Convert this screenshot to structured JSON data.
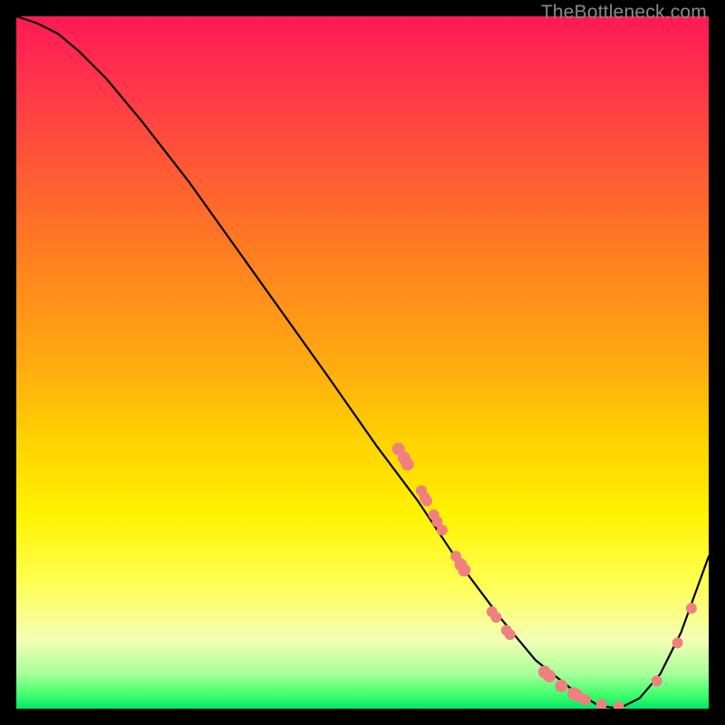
{
  "watermark": "TheBottleneck.com",
  "chart_data": {
    "type": "line",
    "title": "",
    "xlabel": "",
    "ylabel": "",
    "xlim": [
      0,
      100
    ],
    "ylim": [
      0,
      100
    ],
    "grid": false,
    "legend": false,
    "series": [
      {
        "name": "curve",
        "x": [
          0,
          3,
          6,
          9,
          13,
          18,
          25,
          35,
          45,
          52,
          58,
          64,
          70,
          75,
          80,
          84,
          87,
          90,
          93,
          96,
          100
        ],
        "y": [
          100,
          99,
          97.5,
          95,
          91,
          85,
          76,
          62,
          48,
          38,
          30,
          21,
          13,
          7,
          3,
          0.5,
          0,
          1.5,
          5,
          11,
          22
        ]
      }
    ],
    "points": [
      {
        "x": 55.2,
        "y": 37.5,
        "r": 7
      },
      {
        "x": 56.0,
        "y": 36.2,
        "r": 7
      },
      {
        "x": 56.5,
        "y": 35.3,
        "r": 7
      },
      {
        "x": 58.5,
        "y": 31.5,
        "r": 6
      },
      {
        "x": 59.0,
        "y": 30.5,
        "r": 6
      },
      {
        "x": 59.3,
        "y": 30.0,
        "r": 6
      },
      {
        "x": 60.3,
        "y": 28.0,
        "r": 6
      },
      {
        "x": 60.8,
        "y": 27.0,
        "r": 6
      },
      {
        "x": 61.5,
        "y": 25.8,
        "r": 6
      },
      {
        "x": 63.5,
        "y": 22.0,
        "r": 6
      },
      {
        "x": 64.2,
        "y": 20.8,
        "r": 7
      },
      {
        "x": 64.7,
        "y": 20.0,
        "r": 7
      },
      {
        "x": 68.7,
        "y": 14.0,
        "r": 6
      },
      {
        "x": 69.3,
        "y": 13.2,
        "r": 6
      },
      {
        "x": 70.8,
        "y": 11.3,
        "r": 6
      },
      {
        "x": 71.3,
        "y": 10.7,
        "r": 6
      },
      {
        "x": 76.3,
        "y": 5.3,
        "r": 7
      },
      {
        "x": 77.0,
        "y": 4.7,
        "r": 7
      },
      {
        "x": 78.7,
        "y": 3.3,
        "r": 7
      },
      {
        "x": 80.5,
        "y": 2.2,
        "r": 7
      },
      {
        "x": 81.0,
        "y": 1.9,
        "r": 7
      },
      {
        "x": 82.2,
        "y": 1.3,
        "r": 6
      },
      {
        "x": 84.5,
        "y": 0.6,
        "r": 6
      },
      {
        "x": 87.0,
        "y": 0.3,
        "r": 6
      },
      {
        "x": 92.5,
        "y": 4.0,
        "r": 6
      },
      {
        "x": 95.5,
        "y": 9.5,
        "r": 6
      },
      {
        "x": 97.5,
        "y": 14.5,
        "r": 6
      }
    ],
    "colors": {
      "curve": "#000000",
      "points": "#f08080",
      "gradient_top": "#ff1a55",
      "gradient_bottom": "#00e86a"
    }
  }
}
